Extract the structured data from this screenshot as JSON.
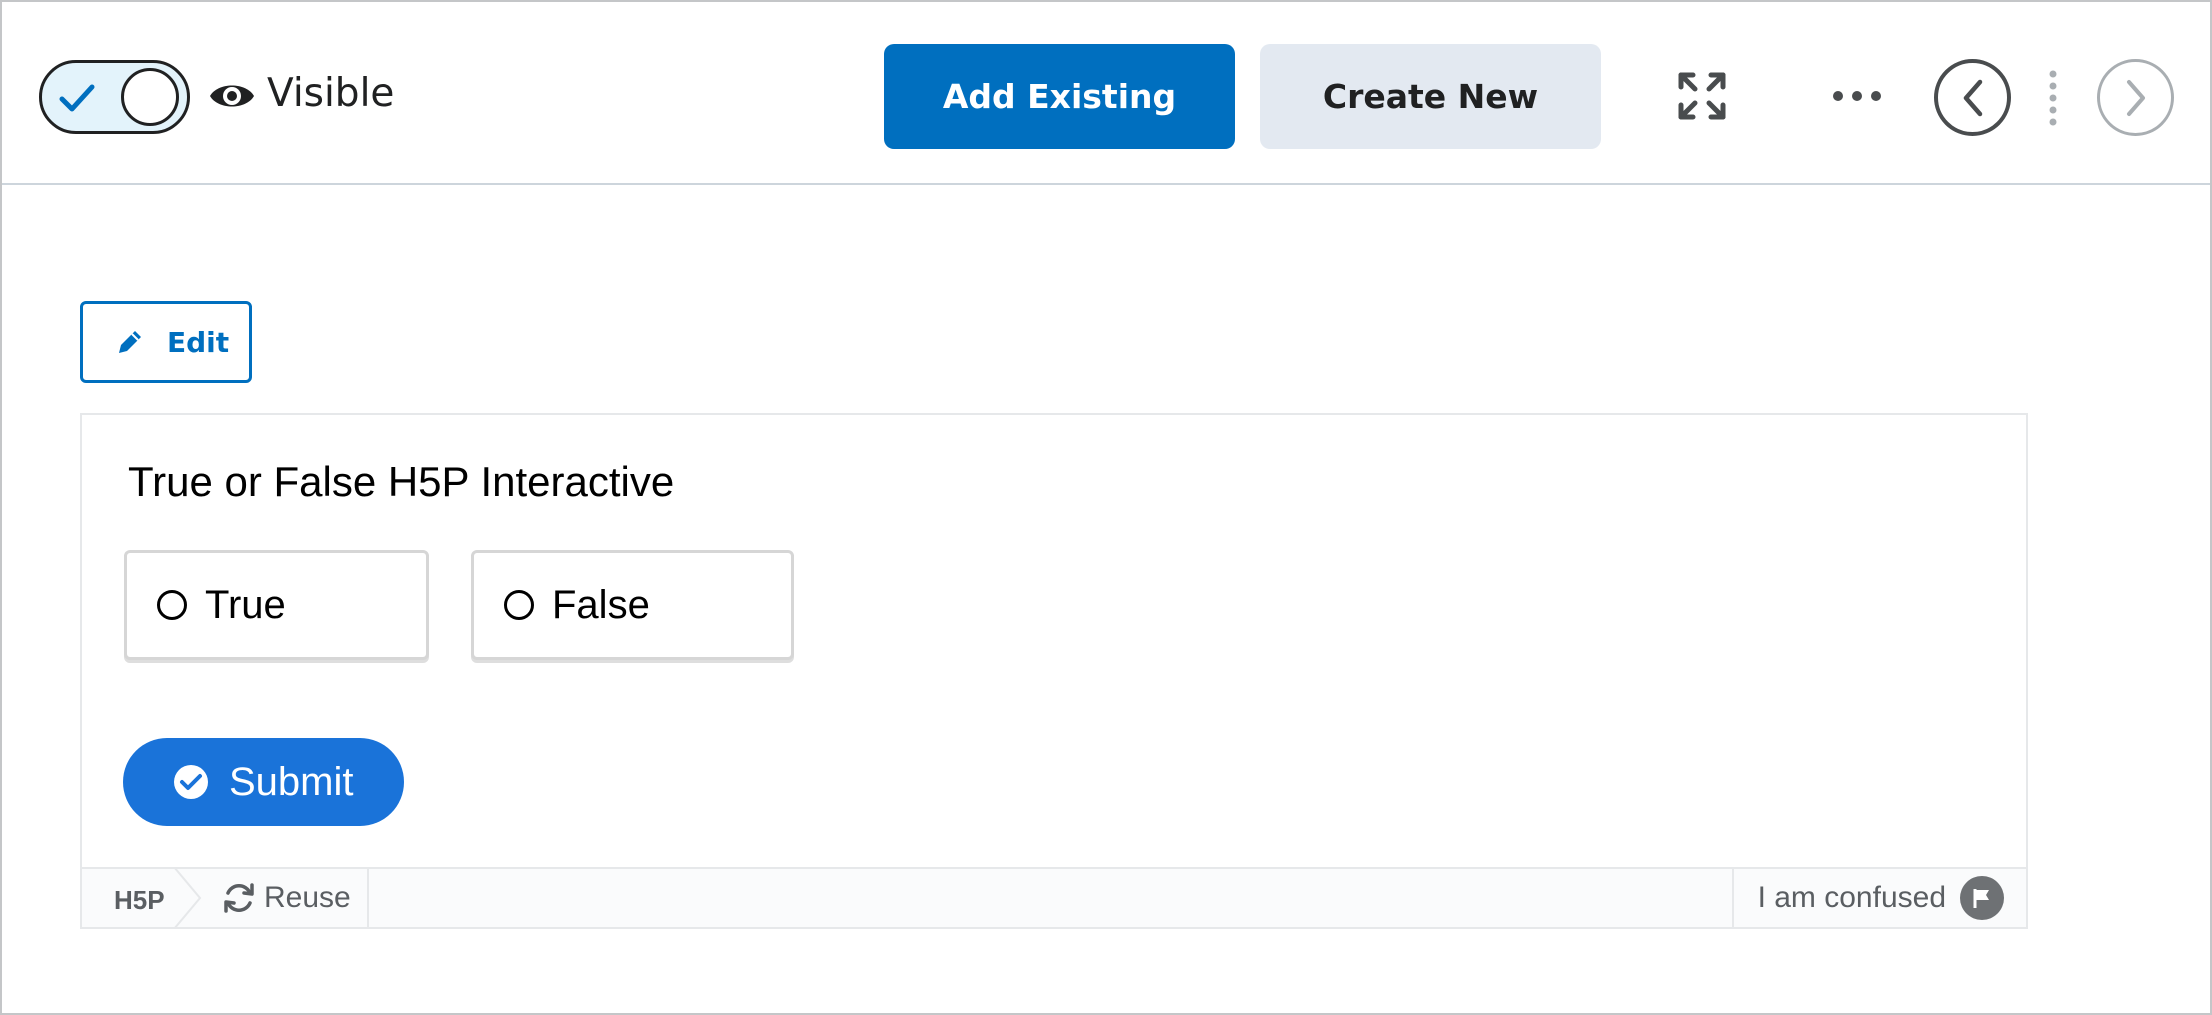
{
  "topbar": {
    "visibility_label": "Visible",
    "toggle_on": true,
    "add_existing_label": "Add Existing",
    "create_new_label": "Create New",
    "icons": [
      "check-icon",
      "eye-icon",
      "expand-icon",
      "more-options-icon",
      "previous-icon",
      "next-icon"
    ]
  },
  "edit": {
    "label": "Edit",
    "icon": "pencil-icon"
  },
  "h5p": {
    "title": "True or False H5P Interactive",
    "answers": [
      {
        "label": "True"
      },
      {
        "label": "False"
      }
    ],
    "submit_label": "Submit",
    "footer": {
      "logo": "H5P",
      "reuse_label": "Reuse",
      "confused_label": "I am confused"
    }
  },
  "colors": {
    "primary": "#006fbf",
    "secondary_bg": "#e3e9f1",
    "submit": "#1a73d9",
    "toggle_bg": "#e3f3fb"
  }
}
